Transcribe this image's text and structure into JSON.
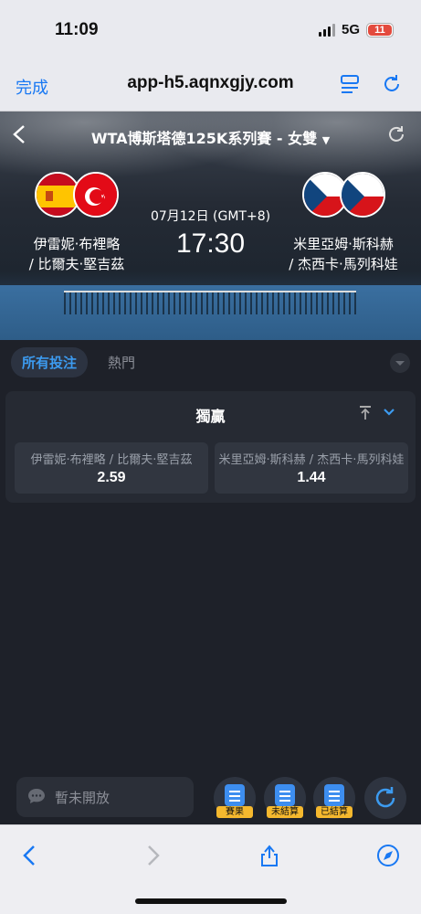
{
  "status_bar": {
    "time": "11:09",
    "network": "5G",
    "battery": "11"
  },
  "url_bar": {
    "done_label": "完成",
    "url": "app-h5.aqnxgjy.com"
  },
  "match": {
    "title": "WTA博斯塔德125K系列賽 - 女雙",
    "date": "07月12日 (GMT+8)",
    "time": "17:30",
    "home_team_line1": "伊雷妮·布裡略",
    "home_team_line2": "/ 比爾夫·堅吉茲",
    "away_team_line1": "米里亞姆·斯科赫",
    "away_team_line2": "/ 杰西卡·馬列科娃",
    "home_flags": [
      "spain-flag",
      "turkey-flag"
    ],
    "away_flags": [
      "czech-flag",
      "czech-flag"
    ]
  },
  "tabs": {
    "active": "所有投注",
    "other": "熱門"
  },
  "market": {
    "title": "獨贏",
    "options": [
      {
        "label": "伊雷妮·布裡略 / 比爾夫·堅吉茲",
        "odds": "2.59"
      },
      {
        "label": "米里亞姆·斯科赫 / 杰西卡·馬列科娃",
        "odds": "1.44"
      }
    ]
  },
  "bottom_tools": {
    "chat_placeholder": "暫未開放",
    "buttons": [
      "賽果",
      "未結算",
      "已結算"
    ]
  },
  "colors": {
    "accent": "#3c9bf0",
    "badge": "#f5b82e",
    "background": "#1e2129"
  }
}
